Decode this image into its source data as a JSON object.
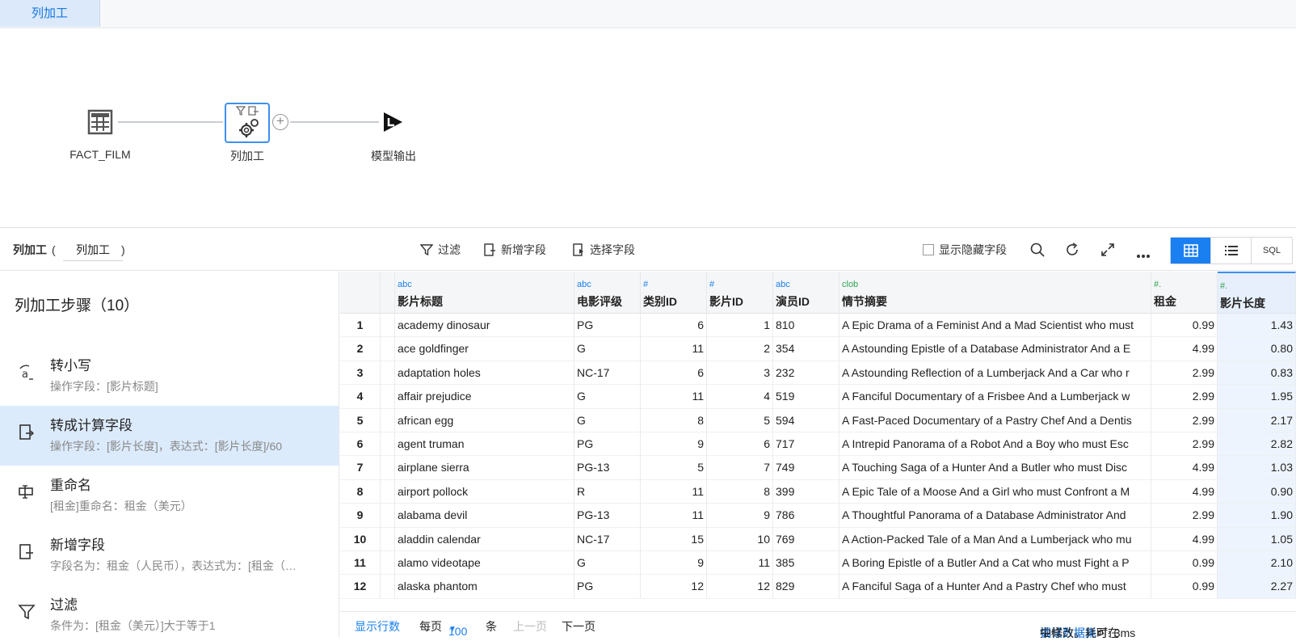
{
  "tab": {
    "label": "列加工"
  },
  "flow": {
    "nodes": [
      {
        "label": "FACT_FILM"
      },
      {
        "label": "列加工"
      },
      {
        "label": "模型输出"
      }
    ]
  },
  "toolbar": {
    "title": "列加工",
    "title_paren_open": "(",
    "title_paren_close": ")",
    "node_name": "列加工",
    "filter_label": "过滤",
    "add_field_label": "新增字段",
    "select_field_label": "选择字段",
    "show_hidden_label": "显示隐藏字段",
    "sql_label": "SQL"
  },
  "steps": {
    "header": "列加工步骤（10）",
    "items": [
      {
        "title": "转小写",
        "sub": "操作字段：[影片标题]",
        "icon": "lowercase-icon"
      },
      {
        "title": "转成计算字段",
        "sub": "操作字段：[影片长度]，表达式：[影片长度]/60",
        "icon": "calc-field-icon"
      },
      {
        "title": "重命名",
        "sub": "[租金]重命名：租金（美元）",
        "icon": "rename-icon"
      },
      {
        "title": "新增字段",
        "sub": "字段名为：租金（人民币），表达式为：[租金（…",
        "icon": "add-field-icon"
      },
      {
        "title": "过滤",
        "sub": "条件为：[租金（美元）]大于等于1",
        "icon": "filter-icon"
      }
    ]
  },
  "table": {
    "columns": [
      {
        "type": "abc",
        "name": "影片标题"
      },
      {
        "type": "abc",
        "name": "电影评级"
      },
      {
        "type": "#",
        "name": "类别ID"
      },
      {
        "type": "#",
        "name": "影片ID"
      },
      {
        "type": "abc",
        "name": "演员ID"
      },
      {
        "type": "clob",
        "name": "情节摘要"
      },
      {
        "type": "#.",
        "name": "租金"
      },
      {
        "type": "#.",
        "name": "影片长度"
      }
    ],
    "rows": [
      [
        "1",
        "academy dinosaur",
        "PG",
        "6",
        "1",
        "810",
        "A Epic Drama of a Feminist And a Mad Scientist who must",
        "0.99",
        "1.43"
      ],
      [
        "2",
        "ace goldfinger",
        "G",
        "11",
        "2",
        "354",
        "A Astounding Epistle of a Database Administrator And a E",
        "4.99",
        "0.80"
      ],
      [
        "3",
        "adaptation holes",
        "NC-17",
        "6",
        "3",
        "232",
        "A Astounding Reflection of a Lumberjack And a Car who r",
        "2.99",
        "0.83"
      ],
      [
        "4",
        "affair prejudice",
        "G",
        "11",
        "4",
        "519",
        "A Fanciful Documentary of a Frisbee And a Lumberjack w",
        "2.99",
        "1.95"
      ],
      [
        "5",
        "african egg",
        "G",
        "8",
        "5",
        "594",
        "A Fast-Paced Documentary of a Pastry Chef And a Dentis",
        "2.99",
        "2.17"
      ],
      [
        "6",
        "agent truman",
        "PG",
        "9",
        "6",
        "717",
        "A Intrepid Panorama of a Robot And a Boy who must Esc",
        "2.99",
        "2.82"
      ],
      [
        "7",
        "airplane sierra",
        "PG-13",
        "5",
        "7",
        "749",
        "A Touching Saga of a Hunter And a Butler who must Disc",
        "4.99",
        "1.03"
      ],
      [
        "8",
        "airport pollock",
        "R",
        "11",
        "8",
        "399",
        "A Epic Tale of a Moose And a Girl who must Confront a M",
        "4.99",
        "0.90"
      ],
      [
        "9",
        "alabama devil",
        "PG-13",
        "11",
        "9",
        "786",
        "A Thoughtful Panorama of a Database Administrator And",
        "2.99",
        "1.90"
      ],
      [
        "10",
        "aladdin calendar",
        "NC-17",
        "15",
        "10",
        "769",
        "A Action-Packed Tale of a Man And a Lumberjack who mu",
        "4.99",
        "1.05"
      ],
      [
        "11",
        "alamo videotape",
        "G",
        "9",
        "11",
        "385",
        "A Boring Epistle of a Butler And a Cat who must Fight a P",
        "0.99",
        "2.10"
      ],
      [
        "12",
        "alaska phantom",
        "PG",
        "12",
        "12",
        "829",
        "A Fanciful Saga of a Hunter And a Pastry Chef who must",
        "0.99",
        "2.27"
      ]
    ]
  },
  "footer": {
    "show_rows": "显示行数",
    "per_page": "每页",
    "page_size": "100",
    "unit": "条",
    "prev": "上一页",
    "next": "下一页",
    "note_pre": "抽样数据，可在",
    "note_link": "调试数据集",
    "note_post": "中修改。耗时: 3ms"
  },
  "colors": {
    "accent": "#1a7ff0",
    "selected_bg": "#dcebfc",
    "clob": "#2fa34f"
  }
}
